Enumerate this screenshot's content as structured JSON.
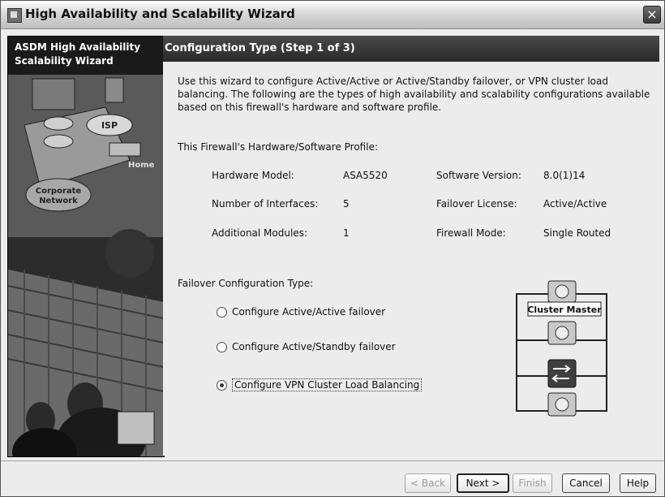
{
  "window": {
    "title": "High Availability and Scalability Wizard",
    "close_glyph": "×"
  },
  "side": {
    "header_line1": "ASDM High Availability",
    "header_line2": "Scalability Wizard",
    "art_isp": "ISP",
    "art_home": "Home",
    "art_corporate_line1": "Corporate",
    "art_corporate_line2": "Network"
  },
  "step": {
    "title": "Configuration Type (Step 1 of 3)"
  },
  "intro": "Use this wizard to configure Active/Active or Active/Standby failover, or VPN cluster load balancing. The following are the types of high availability and scalability configurations available based on this firewall's hardware and software profile.",
  "profile": {
    "heading": "This Firewall's Hardware/Software Profile:",
    "rows": [
      {
        "left_label": "Hardware Model:",
        "left_value": "ASA5520",
        "right_label": "Software Version:",
        "right_value": "8.0(1)14"
      },
      {
        "left_label": "Number of Interfaces:",
        "left_value": "5",
        "right_label": "Failover License:",
        "right_value": "Active/Active"
      },
      {
        "left_label": "Additional  Modules:",
        "left_value": "1",
        "right_label": "Firewall Mode:",
        "right_value": "Single Routed"
      }
    ]
  },
  "failover": {
    "heading": "Failover Configuration Type:",
    "options": [
      {
        "label": "Configure Active/Active failover",
        "selected": false
      },
      {
        "label": "Configure Active/Standby failover",
        "selected": false
      },
      {
        "label": "Configure VPN Cluster Load Balancing",
        "selected": true
      }
    ]
  },
  "diagram": {
    "master_label": "Cluster Master"
  },
  "buttons": {
    "back": "< Back",
    "next": "Next >",
    "finish": "Finish",
    "cancel": "Cancel",
    "help": "Help"
  },
  "icons": [
    "app-icon",
    "close-icon",
    "vpn-concentrator-icon",
    "switch-icon"
  ]
}
